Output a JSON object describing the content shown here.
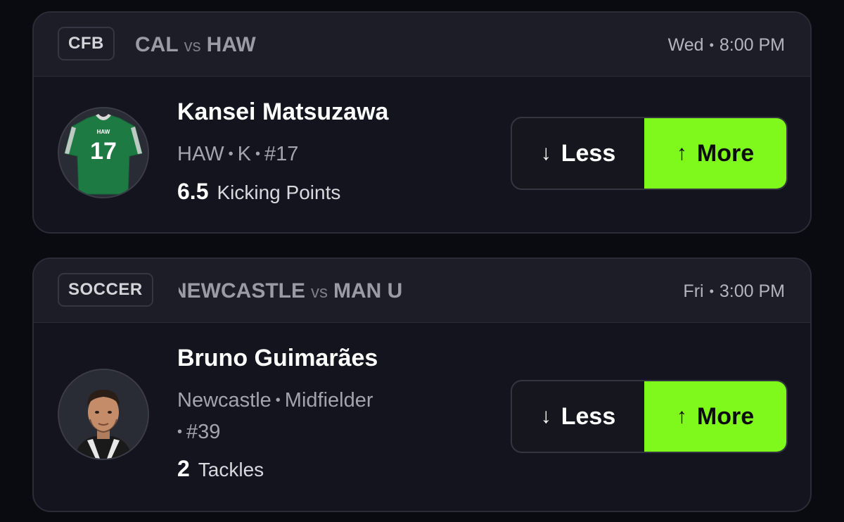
{
  "cards": [
    {
      "sport": "CFB",
      "team_a": "CAL",
      "vs": "vs",
      "team_b": "HAW",
      "day": "Wed",
      "time": "8:00 PM",
      "player_name": "Kansei Matsuzawa",
      "meta_team": "HAW",
      "meta_position": "K",
      "meta_number": "#17",
      "stat_value": "6.5",
      "stat_type": "Kicking Points",
      "jersey_text": "HAW",
      "jersey_number": "17",
      "less_label": "Less",
      "more_label": "More"
    },
    {
      "sport": "SOCCER",
      "team_a": "NEWCASTLE",
      "vs": "vs",
      "team_b": "MAN U",
      "day": "Fri",
      "time": "3:00 PM",
      "player_name": "Bruno Guimarães",
      "meta_team": "Newcastle",
      "meta_position": "Midfielder",
      "meta_number": "#39",
      "stat_value": "2",
      "stat_type": "Tackles",
      "less_label": "Less",
      "more_label": "More"
    }
  ],
  "colors": {
    "background": "#0a0b10",
    "card": "#13141d",
    "header": "#1c1d26",
    "more_accent": "#7ff81c",
    "jersey_green": "#1e7a43"
  },
  "icons": {
    "less": "arrow-down-icon",
    "more": "arrow-up-icon"
  }
}
